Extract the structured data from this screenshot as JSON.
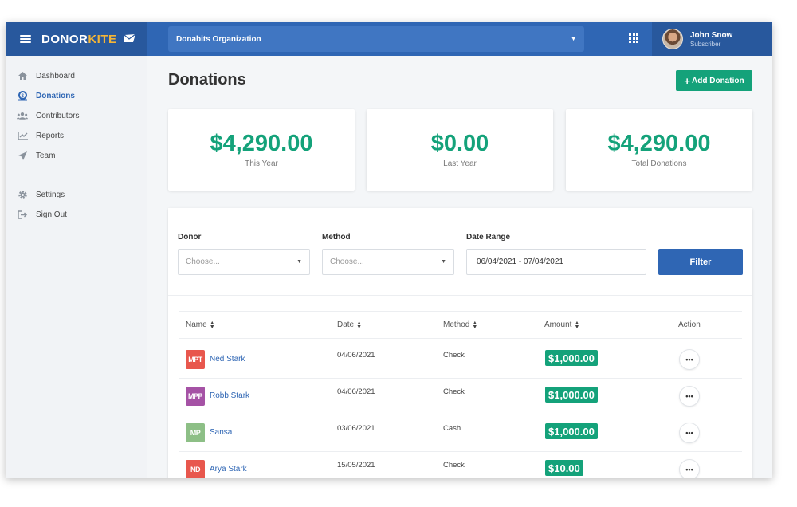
{
  "brand": {
    "part1": "DONOR",
    "part2": "KITE"
  },
  "colors": {
    "primary": "#2f66b4",
    "accent": "#14a27a",
    "brand_highlight": "#f4b537"
  },
  "org_select": {
    "value": "Donabits Organization"
  },
  "user": {
    "name": "John Snow",
    "role": "Subscriber"
  },
  "sidebar": {
    "items": [
      {
        "label": "Dashboard",
        "icon": "home-icon"
      },
      {
        "label": "Donations",
        "icon": "donation-icon"
      },
      {
        "label": "Contributors",
        "icon": "users-icon"
      },
      {
        "label": "Reports",
        "icon": "chart-icon"
      },
      {
        "label": "Team",
        "icon": "paper-plane-icon"
      },
      {
        "label": "Settings",
        "icon": "gear-icon"
      },
      {
        "label": "Sign Out",
        "icon": "sign-out-icon"
      }
    ]
  },
  "page": {
    "title": "Donations",
    "add_button": "Add Donation"
  },
  "stats": [
    {
      "value": "$4,290.00",
      "label": "This Year"
    },
    {
      "value": "$0.00",
      "label": "Last Year"
    },
    {
      "value": "$4,290.00",
      "label": "Total Donations"
    }
  ],
  "filters": {
    "donor_label": "Donor",
    "donor_placeholder": "Choose...",
    "method_label": "Method",
    "method_placeholder": "Choose...",
    "date_label": "Date Range",
    "date_value": "06/04/2021 - 07/04/2021",
    "filter_button": "Filter"
  },
  "table": {
    "headers": [
      "Name",
      "Date",
      "Method",
      "Amount",
      "Action"
    ],
    "rows": [
      {
        "initials": "MPT",
        "badge_color": "#e8574d",
        "name": "Ned Stark",
        "date": "04/06/2021",
        "method": "Check",
        "amount": "$1,000.00"
      },
      {
        "initials": "MPP",
        "badge_color": "#a552a5",
        "name": "Robb Stark",
        "date": "04/06/2021",
        "method": "Check",
        "amount": "$1,000.00"
      },
      {
        "initials": "MP",
        "badge_color": "#8dbf86",
        "name": "Sansa",
        "date": "03/06/2021",
        "method": "Cash",
        "amount": "$1,000.00"
      },
      {
        "initials": "ND",
        "badge_color": "#e8574d",
        "name": "Arya Stark",
        "date": "15/05/2021",
        "method": "Check",
        "amount": "$10.00"
      }
    ],
    "action_label": "•••"
  }
}
